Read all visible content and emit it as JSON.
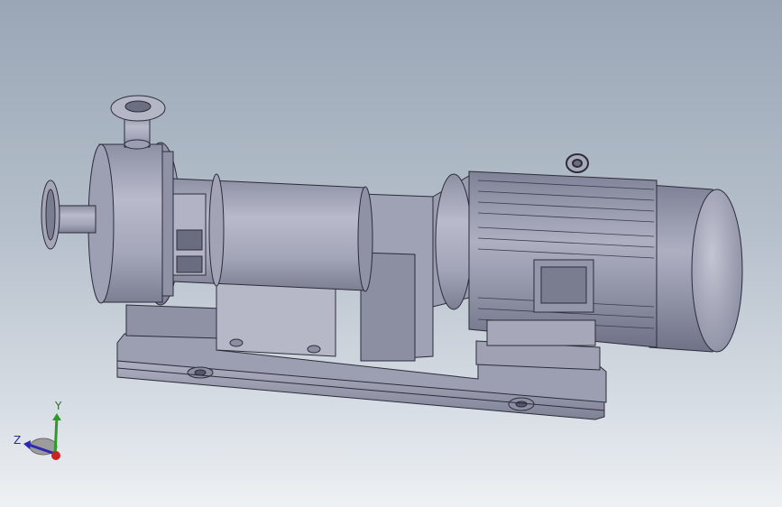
{
  "scene": {
    "model": "centrifugal-pump-with-motor",
    "background_top": "#9aa6b6",
    "background_bottom": "#eef1f4",
    "part_color": "#a9abbd"
  },
  "triad": {
    "y_label": "Y",
    "z_label": "Z",
    "x_color": "#cc2222",
    "y_color": "#2e9a2e",
    "z_color": "#2a2ab0"
  }
}
